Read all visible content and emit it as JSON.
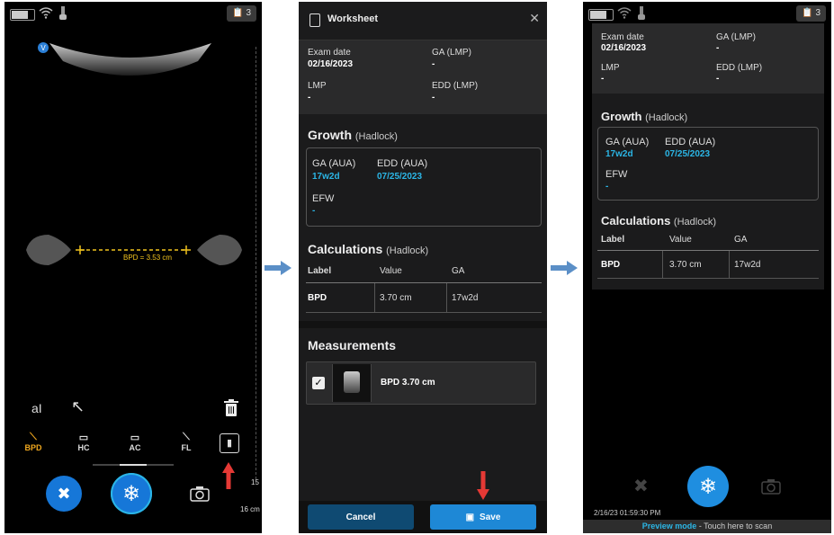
{
  "scan": {
    "badge": "3",
    "mode_icon": "V",
    "measurement": "BPD = 3.53 cm",
    "tools": [
      "BPD",
      "HC",
      "AC",
      "FL"
    ],
    "depth_labels": [
      "15",
      "16 cm"
    ],
    "colors": {
      "accent": "#2bb6e6",
      "tool_active": "#f0a81e",
      "caliper": "#f0c21e"
    }
  },
  "worksheet": {
    "title": "Worksheet",
    "exam_date_label": "Exam date",
    "exam_date": "02/16/2023",
    "ga_lmp_label": "GA (LMP)",
    "ga_lmp": "-",
    "lmp_label": "LMP",
    "lmp": "-",
    "edd_lmp_label": "EDD (LMP)",
    "edd_lmp": "-",
    "growth_title": "Growth",
    "growth_sub": "(Hadlock)",
    "ga_aua_label": "GA (AUA)",
    "ga_aua": "17w2d",
    "edd_aua_label": "EDD (AUA)",
    "edd_aua": "07/25/2023",
    "efw_label": "EFW",
    "efw": "-",
    "calc_title": "Calculations",
    "calc_sub": "(Hadlock)",
    "col_label": "Label",
    "col_value": "Value",
    "col_ga": "GA",
    "row_label": "BPD",
    "row_value": "3.70 cm",
    "row_ga": "17w2d",
    "meas_title": "Measurements",
    "meas_item": "BPD 3.70 cm",
    "cancel": "Cancel",
    "save": "Save"
  },
  "preview": {
    "badge": "3",
    "timestamp": "2/16/23 01:59:30 PM",
    "mode_label": "Preview mode",
    "mode_hint": " - Touch here to scan"
  }
}
